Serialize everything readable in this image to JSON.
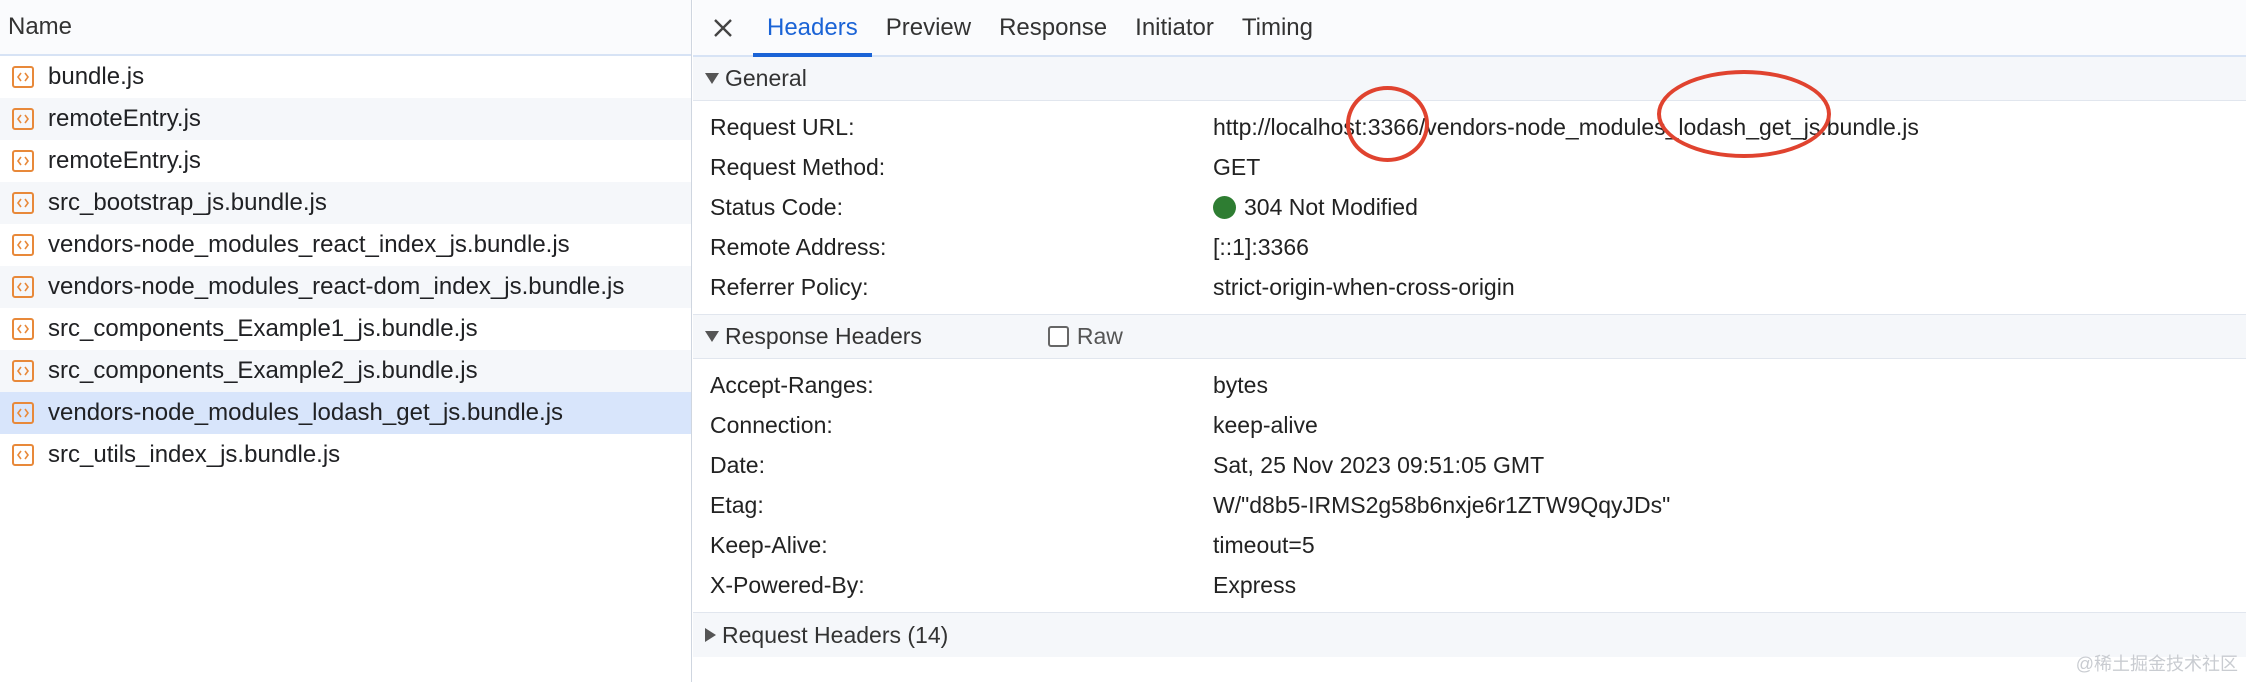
{
  "list": {
    "header": "Name",
    "items": [
      "bundle.js",
      "remoteEntry.js",
      "remoteEntry.js",
      "src_bootstrap_js.bundle.js",
      "vendors-node_modules_react_index_js.bundle.js",
      "vendors-node_modules_react-dom_index_js.bundle.js",
      "src_components_Example1_js.bundle.js",
      "src_components_Example2_js.bundle.js",
      "vendors-node_modules_lodash_get_js.bundle.js",
      "src_utils_index_js.bundle.js"
    ],
    "selected_index": 8
  },
  "tabs": [
    "Headers",
    "Preview",
    "Response",
    "Initiator",
    "Timing"
  ],
  "active_tab": "Headers",
  "general": {
    "title": "General",
    "rows": [
      {
        "key": "Request URL:",
        "value": "http://localhost:3366/vendors-node_modules_lodash_get_js.bundle.js"
      },
      {
        "key": "Request Method:",
        "value": "GET"
      },
      {
        "key": "Status Code:",
        "value": "304 Not Modified"
      },
      {
        "key": "Remote Address:",
        "value": "[::1]:3366"
      },
      {
        "key": "Referrer Policy:",
        "value": "strict-origin-when-cross-origin"
      }
    ]
  },
  "response_headers": {
    "title": "Response Headers",
    "raw_label": "Raw",
    "rows": [
      {
        "key": "Accept-Ranges:",
        "value": "bytes"
      },
      {
        "key": "Connection:",
        "value": "keep-alive"
      },
      {
        "key": "Date:",
        "value": "Sat, 25 Nov 2023 09:51:05 GMT"
      },
      {
        "key": "Etag:",
        "value": "W/\"d8b5-IRMS2g58b6nxje6r1ZTW9QqyJDs\""
      },
      {
        "key": "Keep-Alive:",
        "value": "timeout=5"
      },
      {
        "key": "X-Powered-By:",
        "value": "Express"
      }
    ]
  },
  "request_headers": {
    "title": "Request Headers (14)"
  },
  "watermark": "@稀土掘金技术社区",
  "colors": {
    "accent": "#1a63d6",
    "status_ok": "#2e7d32",
    "annotation": "#e0432f",
    "file_icon": "#e8893a"
  }
}
